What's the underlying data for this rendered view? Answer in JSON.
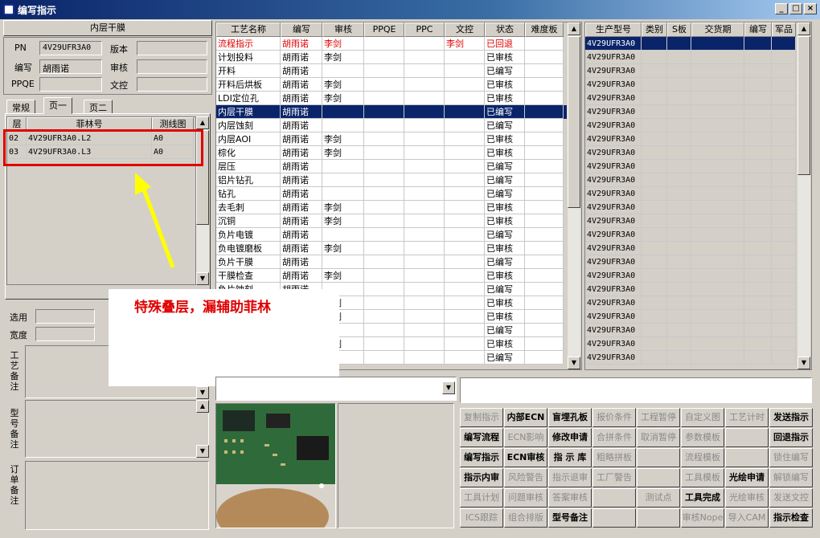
{
  "window": {
    "title": "编写指示",
    "min": "_",
    "max": "□",
    "close": "×"
  },
  "left": {
    "section_title": "内层干膜",
    "pn_label": "PN",
    "pn_value": "4V29UFR3A0",
    "version_label": "版本",
    "version_value": "",
    "writer_label": "编写",
    "writer_value": "胡雨诺",
    "review_label": "审核",
    "review_value": "",
    "ppqe_label": "PPQE",
    "ppqe_value": "",
    "doc_label": "文控",
    "doc_value": "",
    "tabs": [
      "常规",
      "页一",
      "页二"
    ],
    "layer_headers": [
      "层",
      "菲林号",
      "测线图"
    ],
    "layers": [
      {
        "layer": "02",
        "film": "4V29UFR3A0.L2",
        "test": "A0"
      },
      {
        "layer": "03",
        "film": "4V29UFR3A0.L3",
        "test": "A0"
      }
    ],
    "use_label": "选用",
    "width_label": "宽度",
    "remark_process": "工艺备注",
    "remark_model": "型号备注",
    "remark_order": "订单备注"
  },
  "annotation": {
    "text": "特殊叠层，漏辅助菲林",
    "color": "#e00000",
    "arrow_color": "#ffff00",
    "box_color": "#e00000"
  },
  "process": {
    "headers": [
      "工艺名称",
      "编写",
      "审核",
      "PPQE",
      "PPC",
      "文控",
      "状态",
      "难度板"
    ],
    "rows": [
      {
        "name": "流程指示",
        "writer": "胡雨诺",
        "review": "李剑",
        "ppqe": "",
        "ppc": "",
        "doc": "李剑",
        "status": "已回退",
        "red": true
      },
      {
        "name": "计划投料",
        "writer": "胡雨诺",
        "review": "李剑",
        "ppqe": "",
        "ppc": "",
        "doc": "",
        "status": "已审核"
      },
      {
        "name": "开料",
        "writer": "胡雨诺",
        "review": "",
        "ppqe": "",
        "ppc": "",
        "doc": "",
        "status": "已编写"
      },
      {
        "name": "开料后烘板",
        "writer": "胡雨诺",
        "review": "李剑",
        "ppqe": "",
        "ppc": "",
        "doc": "",
        "status": "已审核"
      },
      {
        "name": "LDI定位孔",
        "writer": "胡雨诺",
        "review": "李剑",
        "ppqe": "",
        "ppc": "",
        "doc": "",
        "status": "已审核"
      },
      {
        "name": "内层干膜",
        "writer": "胡雨诺",
        "review": "",
        "ppqe": "",
        "ppc": "",
        "doc": "",
        "status": "已编写",
        "selected": true
      },
      {
        "name": "内层蚀刻",
        "writer": "胡雨诺",
        "review": "",
        "ppqe": "",
        "ppc": "",
        "doc": "",
        "status": "已编写"
      },
      {
        "name": "内层AOI",
        "writer": "胡雨诺",
        "review": "李剑",
        "ppqe": "",
        "ppc": "",
        "doc": "",
        "status": "已审核"
      },
      {
        "name": "棕化",
        "writer": "胡雨诺",
        "review": "李剑",
        "ppqe": "",
        "ppc": "",
        "doc": "",
        "status": "已审核"
      },
      {
        "name": "层压",
        "writer": "胡雨诺",
        "review": "",
        "ppqe": "",
        "ppc": "",
        "doc": "",
        "status": "已编写"
      },
      {
        "name": "铝片钻孔",
        "writer": "胡雨诺",
        "review": "",
        "ppqe": "",
        "ppc": "",
        "doc": "",
        "status": "已编写"
      },
      {
        "name": "钻孔",
        "writer": "胡雨诺",
        "review": "",
        "ppqe": "",
        "ppc": "",
        "doc": "",
        "status": "已编写"
      },
      {
        "name": "去毛刺",
        "writer": "胡雨诺",
        "review": "李剑",
        "ppqe": "",
        "ppc": "",
        "doc": "",
        "status": "已审核"
      },
      {
        "name": "沉铜",
        "writer": "胡雨诺",
        "review": "李剑",
        "ppqe": "",
        "ppc": "",
        "doc": "",
        "status": "已审核"
      },
      {
        "name": "负片电镀",
        "writer": "胡雨诺",
        "review": "",
        "ppqe": "",
        "ppc": "",
        "doc": "",
        "status": "已编写"
      },
      {
        "name": "负电镀磨板",
        "writer": "胡雨诺",
        "review": "李剑",
        "ppqe": "",
        "ppc": "",
        "doc": "",
        "status": "已审核"
      },
      {
        "name": "负片干膜",
        "writer": "胡雨诺",
        "review": "",
        "ppqe": "",
        "ppc": "",
        "doc": "",
        "status": "已编写"
      },
      {
        "name": "干膜检查",
        "writer": "胡雨诺",
        "review": "李剑",
        "ppqe": "",
        "ppc": "",
        "doc": "",
        "status": "已审核"
      },
      {
        "name": "负片蚀刻",
        "writer": "胡雨诺",
        "review": "",
        "ppqe": "",
        "ppc": "",
        "doc": "",
        "status": "已编写"
      },
      {
        "name": "",
        "writer": "",
        "review": "李剑",
        "ppqe": "",
        "ppc": "",
        "doc": "",
        "status": "已审核"
      },
      {
        "name": "",
        "writer": "",
        "review": "李剑",
        "ppqe": "",
        "ppc": "",
        "doc": "",
        "status": "已审核"
      },
      {
        "name": "",
        "writer": "",
        "review": "",
        "ppqe": "",
        "ppc": "",
        "doc": "",
        "status": "已编写"
      },
      {
        "name": "",
        "writer": "",
        "review": "李剑",
        "ppqe": "",
        "ppc": "",
        "doc": "",
        "status": "已审核"
      },
      {
        "name": "",
        "writer": "",
        "review": "",
        "ppqe": "",
        "ppc": "",
        "doc": "",
        "status": "已编写"
      }
    ]
  },
  "models": {
    "headers": [
      "生产型号",
      "类别",
      "S板",
      "交货期",
      "编写",
      "军品"
    ],
    "rows": [
      "4V29UFR3A0",
      "4V29UFR3A0",
      "4V29UFR3A0",
      "4V29UFR3A0",
      "4V29UFR3A0",
      "4V29UFR3A0",
      "4V29UFR3A0",
      "4V29UFR3A0",
      "4V29UFR3A0",
      "4V29UFR3A0",
      "4V29UFR3A0",
      "4V29UFR3A0",
      "4V29UFR3A0",
      "4V29UFR3A0",
      "4V29UFR3A0",
      "4V29UFR3A0",
      "4V29UFR3A0",
      "4V29UFR3A0",
      "4V29UFR3A0",
      "4V29UFR3A0",
      "4V29UFR3A0",
      "4V29UFR3A0",
      "4V29UFR3A0",
      "4V29UFR3A0"
    ]
  },
  "buttons": [
    [
      {
        "t": "复制指示",
        "e": false
      },
      {
        "t": "内部ECN",
        "e": true
      },
      {
        "t": "盲埋孔板",
        "e": true
      },
      {
        "t": "报价条件",
        "e": false
      },
      {
        "t": "工程暂停",
        "e": false
      },
      {
        "t": "自定义图",
        "e": false
      },
      {
        "t": "工艺计时",
        "e": false
      },
      {
        "t": "发送指示",
        "e": true
      }
    ],
    [
      {
        "t": "编写流程",
        "e": true
      },
      {
        "t": "ECN影响",
        "e": false
      },
      {
        "t": "修改申请",
        "e": true
      },
      {
        "t": "合拼条件",
        "e": false
      },
      {
        "t": "取消暂停",
        "e": false
      },
      {
        "t": "参数模板",
        "e": false
      },
      {
        "t": "",
        "e": false
      },
      {
        "t": "回退指示",
        "e": true
      }
    ],
    [
      {
        "t": "编写指示",
        "e": true
      },
      {
        "t": "ECN审核",
        "e": true
      },
      {
        "t": "指 示 库",
        "e": true
      },
      {
        "t": "粗略拼板",
        "e": false
      },
      {
        "t": "",
        "e": false
      },
      {
        "t": "流程模板",
        "e": false
      },
      {
        "t": "",
        "e": false
      },
      {
        "t": "锁住编写",
        "e": false
      }
    ],
    [
      {
        "t": "指示内审",
        "e": true
      },
      {
        "t": "风险警告",
        "e": false
      },
      {
        "t": "指示退审",
        "e": false
      },
      {
        "t": "工厂警告",
        "e": false
      },
      {
        "t": "",
        "e": false
      },
      {
        "t": "工具模板",
        "e": false
      },
      {
        "t": "光绘申请",
        "e": true
      },
      {
        "t": "解锁编写",
        "e": false
      }
    ],
    [
      {
        "t": "工具计划",
        "e": false
      },
      {
        "t": "问题审核",
        "e": false
      },
      {
        "t": "答案审核",
        "e": false
      },
      {
        "t": "",
        "e": false
      },
      {
        "t": "测试点",
        "e": false
      },
      {
        "t": "工具完成",
        "e": true
      },
      {
        "t": "光绘审核",
        "e": false
      },
      {
        "t": "发送文控",
        "e": false
      }
    ],
    [
      {
        "t": "ICS跟踪",
        "e": false
      },
      {
        "t": "组合排版",
        "e": false
      },
      {
        "t": "型号备注",
        "e": true
      },
      {
        "t": "",
        "e": false
      },
      {
        "t": "",
        "e": false
      },
      {
        "t": "审核Nope",
        "e": false
      },
      {
        "t": "导入CAM",
        "e": false
      },
      {
        "t": "指示检查",
        "e": true
      }
    ]
  ]
}
